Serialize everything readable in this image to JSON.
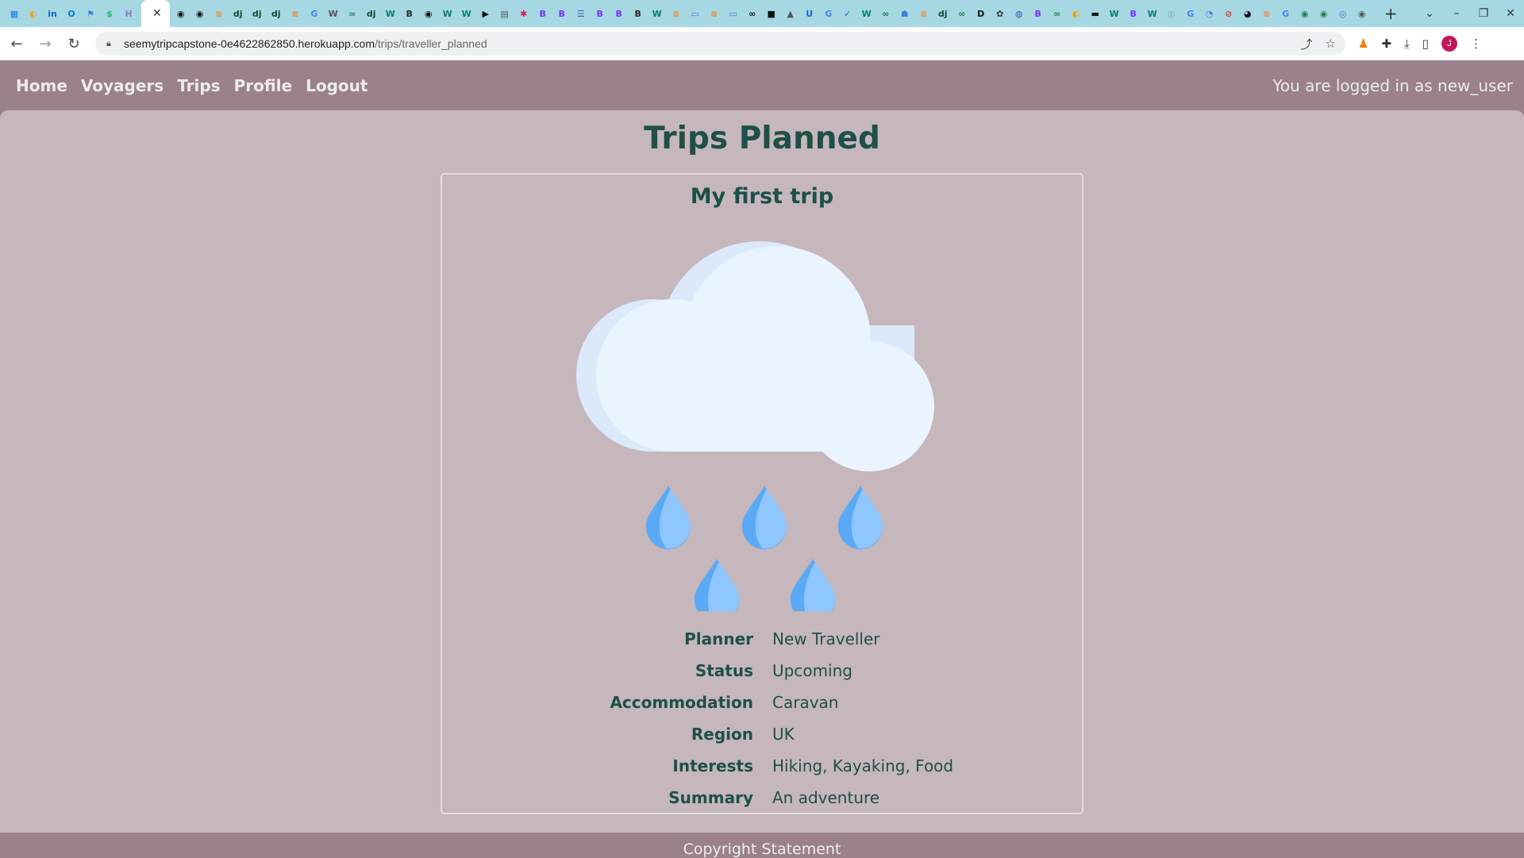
{
  "browser": {
    "active_tab_close": "✕",
    "new_tab": "+",
    "url_host": "seemytripcapstone-0e4622862850.herokuapp.com",
    "url_path": "/trips/traveller_planned",
    "avatar_letter": "J",
    "favicons": [
      {
        "glyph": "▦",
        "color": "#1a73e8"
      },
      {
        "glyph": "◐",
        "color": "#f4a300"
      },
      {
        "glyph": "in",
        "color": "#0a66c2"
      },
      {
        "glyph": "O",
        "color": "#0078d4"
      },
      {
        "glyph": "⚑",
        "color": "#3f7fd6"
      },
      {
        "glyph": "$",
        "color": "#2bb673"
      },
      {
        "glyph": "H",
        "color": "#8e7cc3"
      },
      {
        "glyph": "✕",
        "color": "#444444"
      },
      {
        "glyph": "◉",
        "color": "#111111"
      },
      {
        "glyph": "◉",
        "color": "#111111"
      },
      {
        "glyph": "≋",
        "color": "#f48024"
      },
      {
        "glyph": "dj",
        "color": "#0c4b33"
      },
      {
        "glyph": "dj",
        "color": "#0c4b33"
      },
      {
        "glyph": "dj",
        "color": "#0c4b33"
      },
      {
        "glyph": "≋",
        "color": "#f48024"
      },
      {
        "glyph": "G",
        "color": "#4285f4"
      },
      {
        "glyph": "W",
        "color": "#555555"
      },
      {
        "glyph": "∞",
        "color": "#1e7f4f"
      },
      {
        "glyph": "dj",
        "color": "#0c4b33"
      },
      {
        "glyph": "W",
        "color": "#0c7c6b"
      },
      {
        "glyph": "B",
        "color": "#2a2a2a"
      },
      {
        "glyph": "◉",
        "color": "#111111"
      },
      {
        "glyph": "W",
        "color": "#0c7c6b"
      },
      {
        "glyph": "W",
        "color": "#0c7c6b"
      },
      {
        "glyph": "▶",
        "color": "#111111"
      },
      {
        "glyph": "▤",
        "color": "#555555"
      },
      {
        "glyph": "✱",
        "color": "#d81b60"
      },
      {
        "glyph": "B",
        "color": "#7b2ff7"
      },
      {
        "glyph": "B",
        "color": "#7b2ff7"
      },
      {
        "glyph": "☰",
        "color": "#3f51b5"
      },
      {
        "glyph": "B",
        "color": "#7b2ff7"
      },
      {
        "glyph": "B",
        "color": "#7b2ff7"
      },
      {
        "glyph": "B",
        "color": "#2a2a2a"
      },
      {
        "glyph": "W",
        "color": "#0c7c6b"
      },
      {
        "glyph": "≋",
        "color": "#f48024"
      },
      {
        "glyph": "▭",
        "color": "#3f7fd6"
      },
      {
        "glyph": "≋",
        "color": "#f48024"
      },
      {
        "glyph": "▭",
        "color": "#3f7fd6"
      },
      {
        "glyph": "∞",
        "color": "#111111"
      },
      {
        "glyph": "■",
        "color": "#111111"
      },
      {
        "glyph": "▲",
        "color": "#555555"
      },
      {
        "glyph": "U",
        "color": "#1565c0"
      },
      {
        "glyph": "G",
        "color": "#4285f4"
      },
      {
        "glyph": "✓",
        "color": "#1565c0"
      },
      {
        "glyph": "W",
        "color": "#0c7c6b"
      },
      {
        "glyph": "∞",
        "color": "#1e7f4f"
      },
      {
        "glyph": "☗",
        "color": "#3f7fd6"
      },
      {
        "glyph": "≋",
        "color": "#f48024"
      },
      {
        "glyph": "dj",
        "color": "#0c4b33"
      },
      {
        "glyph": "∞",
        "color": "#1e7f4f"
      },
      {
        "glyph": "D",
        "color": "#111111"
      },
      {
        "glyph": "✿",
        "color": "#333333"
      },
      {
        "glyph": "◍",
        "color": "#3f51b5"
      },
      {
        "glyph": "B",
        "color": "#7b2ff7"
      },
      {
        "glyph": "∞",
        "color": "#1e7f4f"
      },
      {
        "glyph": "◐",
        "color": "#f4a300"
      },
      {
        "glyph": "▬",
        "color": "#111111"
      },
      {
        "glyph": "W",
        "color": "#0c7c6b"
      },
      {
        "glyph": "B",
        "color": "#7b2ff7"
      },
      {
        "glyph": "W",
        "color": "#0c7c6b"
      },
      {
        "glyph": "◎",
        "color": "#7aa"
      },
      {
        "glyph": "G",
        "color": "#4285f4"
      },
      {
        "glyph": "◔",
        "color": "#3f7fd6"
      },
      {
        "glyph": "⊘",
        "color": "#e53935"
      },
      {
        "glyph": "◕",
        "color": "#111111"
      },
      {
        "glyph": "≋",
        "color": "#f48024"
      },
      {
        "glyph": "G",
        "color": "#4285f4"
      },
      {
        "glyph": "◉",
        "color": "#1e7f4f"
      },
      {
        "glyph": "◉",
        "color": "#1e7f4f"
      },
      {
        "glyph": "◎",
        "color": "#5c6bc0"
      },
      {
        "glyph": "◉",
        "color": "#555555"
      }
    ]
  },
  "nav": {
    "links": [
      "Home",
      "Voyagers",
      "Trips",
      "Profile",
      "Logout"
    ],
    "login_status": "You are logged in as new_user"
  },
  "page_title": "Trips Planned",
  "trip": {
    "title": "My first trip",
    "weather_icon": "rain-cloud-icon",
    "details": [
      {
        "label": "Planner",
        "value": "New Traveller"
      },
      {
        "label": "Status",
        "value": "Upcoming"
      },
      {
        "label": "Accommodation",
        "value": "Caravan"
      },
      {
        "label": "Region",
        "value": "UK"
      },
      {
        "label": "Interests",
        "value": "Hiking, Kayaking, Food"
      },
      {
        "label": "Summary",
        "value": "An adventure"
      }
    ]
  },
  "footer": {
    "text": "Copyright Statement"
  },
  "colors": {
    "header_bg": "#9b818d",
    "content_bg": "#c5b7bc",
    "heading": "#1e4f49",
    "cloud_light": "#eaf4ff",
    "cloud_shade": "#dbe9fb",
    "drop_light": "#8ec6ff",
    "drop_dark": "#5aa9f5"
  }
}
